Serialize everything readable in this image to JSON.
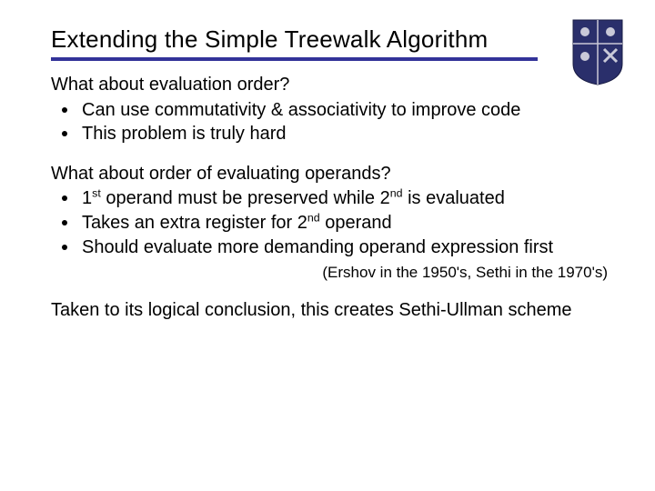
{
  "title": "Extending the Simple Treewalk Algorithm",
  "section1": {
    "lead": "What about evaluation order?",
    "items": [
      "Can use commutativity & associativity to improve code",
      "This problem is truly hard"
    ]
  },
  "section2": {
    "lead": "What about order of evaluating operands?",
    "item0_pre": "1",
    "item0_sup1": "st",
    "item0_mid": " operand must be preserved while 2",
    "item0_sup2": "nd",
    "item0_post": " is evaluated",
    "item1_pre": "Takes an extra register for 2",
    "item1_sup": "nd",
    "item1_post": " operand",
    "item2": "Should evaluate more demanding operand expression first"
  },
  "attribution": "(Ershov in the 1950's, Sethi in the 1970's)",
  "conclusion": "Taken to its logical conclusion, this creates Sethi-Ullman scheme"
}
